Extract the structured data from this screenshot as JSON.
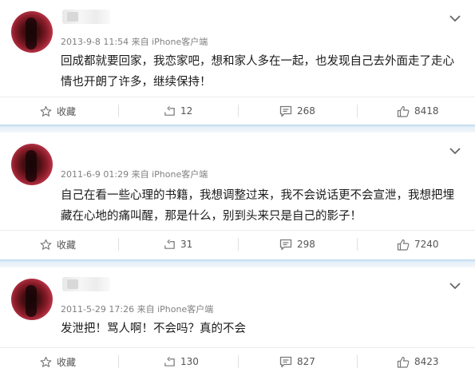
{
  "posts": [
    {
      "meta": "2013-9-8 11:54 来自 iPhone客户端",
      "text": "回成都就要回家，我恋家吧，想和家人多在一起，也发现自己去外面走了走心情也开朗了许多，继续保持！",
      "actions": {
        "favorite": "收藏",
        "reposts": "12",
        "comments": "268",
        "likes": "8418"
      }
    },
    {
      "meta": "2011-6-9 01:29 来自 iPhone客户端",
      "text": "自己在看一些心理的书籍，我想调整过来，我不会说话更不会宣泄，我想把埋藏在心地的痛叫醒，那是什么，别到头来只是自己的影子！",
      "actions": {
        "favorite": "收藏",
        "reposts": "31",
        "comments": "298",
        "likes": "7240"
      }
    },
    {
      "meta": "2011-5-29 17:26 来自 iPhone客户端",
      "text": "发泄把！骂人啊！不会吗？真的不会",
      "actions": {
        "favorite": "收藏",
        "reposts": "130",
        "comments": "827",
        "likes": "8423"
      }
    }
  ],
  "icons": {
    "favorite": "star-outline-icon",
    "repost": "repost-arrow-icon",
    "comment": "comment-bubble-icon",
    "like": "thumbs-up-icon",
    "menu": "chevron-down-icon"
  },
  "colors": {
    "divider": "#d6e6f3",
    "meta": "#808080",
    "text": "#1a1a1a"
  }
}
